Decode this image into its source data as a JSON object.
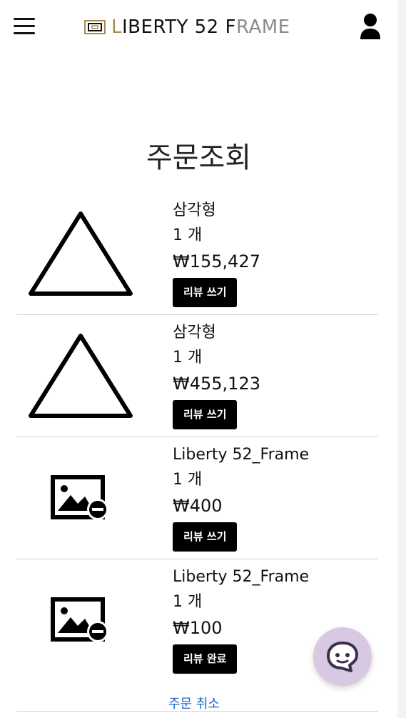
{
  "header": {
    "logo_first_letter": "L",
    "logo_middle": "IBERTY 52 F",
    "logo_rest": "RAME",
    "menu_icon": "hamburger-menu-icon",
    "user_icon": "user-icon"
  },
  "page_title": "주문조회",
  "orders": [
    {
      "name": "삼각형",
      "qty": "1 개",
      "price": "₩155,427",
      "button": "리뷰 쓰기",
      "image": "triangle-image"
    },
    {
      "name": "삼각형",
      "qty": "1 개",
      "price": "₩455,123",
      "button": "리뷰 쓰기",
      "image": "triangle-image"
    },
    {
      "name": "Liberty 52_Frame",
      "qty": "1 개",
      "price": "₩400",
      "button": "리뷰 쓰기",
      "image": "broken-image-icon"
    },
    {
      "name": "Liberty 52_Frame",
      "qty": "1 개",
      "price": "₩100",
      "button": "리뷰 완료",
      "image": "broken-image-icon",
      "cancel_link": "주문 취소"
    }
  ],
  "colors": {
    "logo_gold": "#a58a4e",
    "logo_grey": "#8a8a8a",
    "button_bg": "#000000",
    "link": "#1a64c8",
    "chat_bg": "#d8c8e2"
  },
  "chat_icon": "chat-icon"
}
